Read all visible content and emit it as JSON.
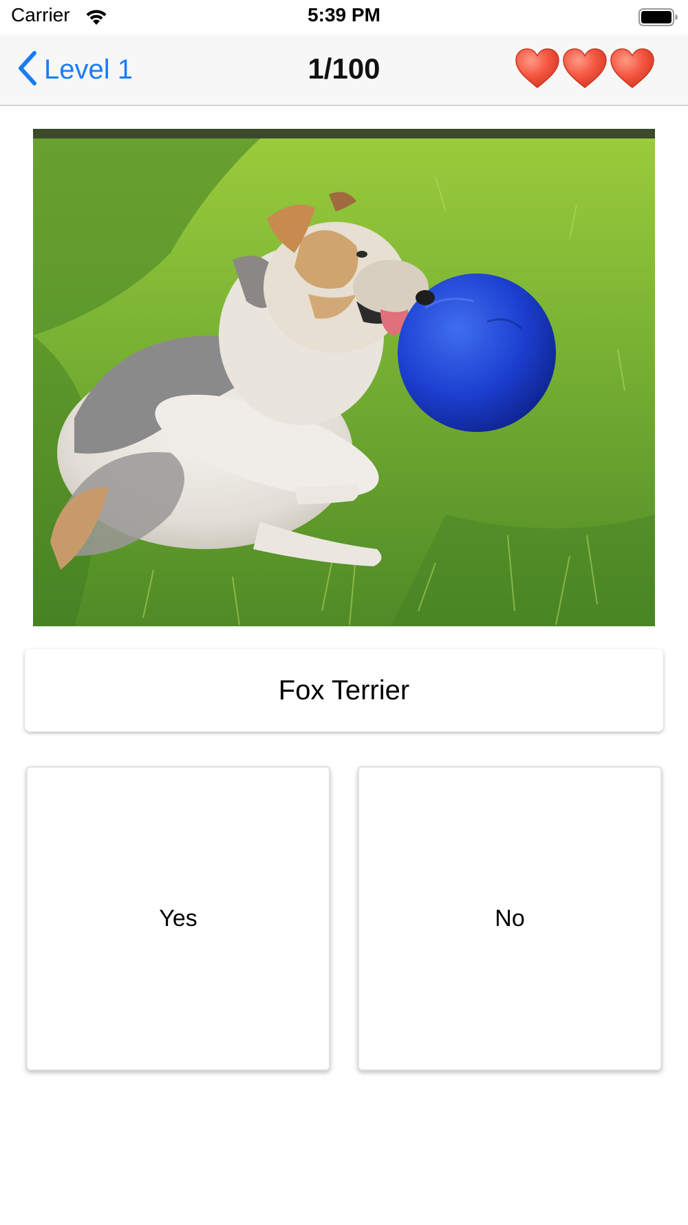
{
  "status_bar": {
    "carrier": "Carrier",
    "time": "5:39 PM",
    "wifi_icon": "wifi-icon",
    "battery_icon": "battery-full-icon"
  },
  "nav": {
    "back_label": "Level 1",
    "back_icon": "chevron-left-icon",
    "title": "1/100",
    "lives": 3,
    "life_icon": "heart-icon",
    "accent_color": "#1a7cf5",
    "heart_color": "#f4553f"
  },
  "question": {
    "photo_icon": "dog-photo",
    "breed_name": "Fox Terrier"
  },
  "answers": {
    "yes_label": "Yes",
    "no_label": "No"
  }
}
